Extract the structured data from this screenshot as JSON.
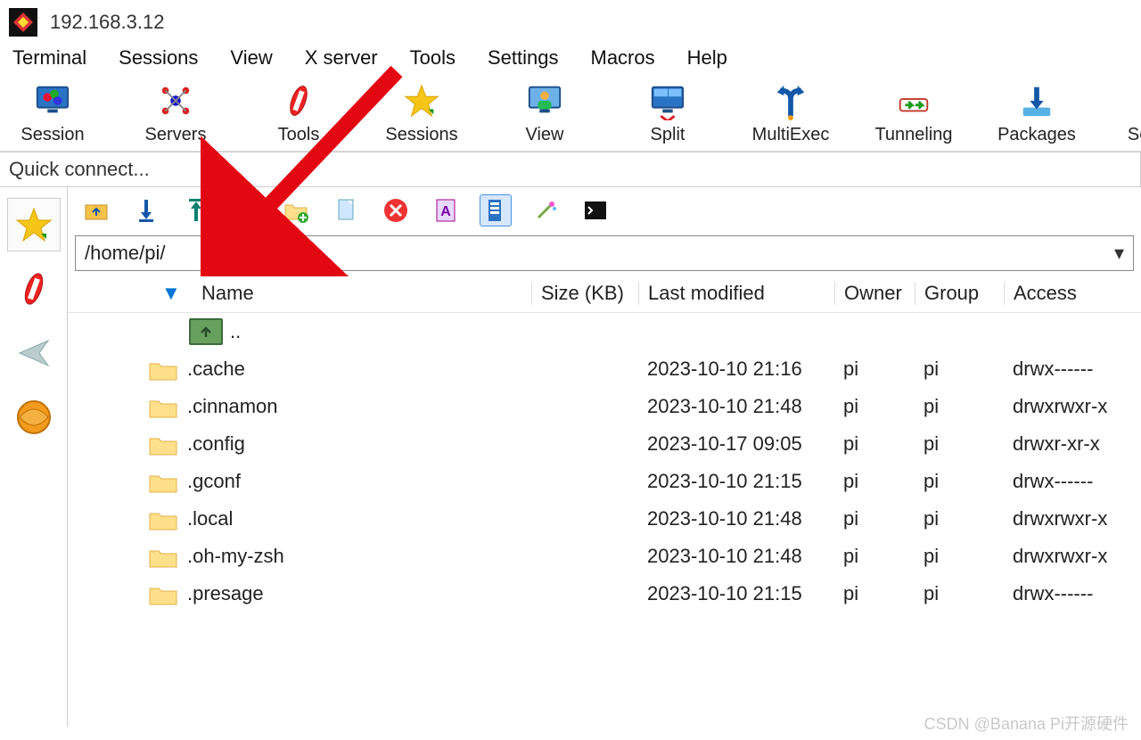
{
  "title": "192.168.3.12",
  "menubar": [
    "Terminal",
    "Sessions",
    "View",
    "X server",
    "Tools",
    "Settings",
    "Macros",
    "Help"
  ],
  "toolbar": [
    {
      "label": "Session",
      "icon": "monitor-rgb"
    },
    {
      "label": "Servers",
      "icon": "nodes"
    },
    {
      "label": "Tools",
      "icon": "swiss-red"
    },
    {
      "label": "Sessions",
      "icon": "star-yellow"
    },
    {
      "label": "View",
      "icon": "monitor-user"
    },
    {
      "label": "Split",
      "icon": "split-blue"
    },
    {
      "label": "MultiExec",
      "icon": "fork-blue"
    },
    {
      "label": "Tunneling",
      "icon": "tunnel-green"
    },
    {
      "label": "Packages",
      "icon": "download-blue"
    },
    {
      "label": "Settings",
      "icon": "gears-blue"
    }
  ],
  "quick_connect_label": "Quick connect...",
  "sidebuttons": [
    "star-yellow",
    "swiss-red",
    "send-gray",
    "globe-orange"
  ],
  "file_toolbar_icons": [
    "up-folder",
    "download-blue",
    "upload-teal",
    "refresh-green",
    "new-folder",
    "new-file",
    "delete-red",
    "font-file",
    "properties",
    "wand",
    "terminal"
  ],
  "path": "/home/pi/",
  "columns": {
    "name": "Name",
    "size": "Size (KB)",
    "modified": "Last modified",
    "owner": "Owner",
    "group": "Group",
    "access": "Access"
  },
  "up_label": "..",
  "files": [
    {
      "name": ".cache",
      "size": "",
      "modified": "2023-10-10 21:16",
      "owner": "pi",
      "group": "pi",
      "access": "drwx------"
    },
    {
      "name": ".cinnamon",
      "size": "",
      "modified": "2023-10-10 21:48",
      "owner": "pi",
      "group": "pi",
      "access": "drwxrwxr-x"
    },
    {
      "name": ".config",
      "size": "",
      "modified": "2023-10-17 09:05",
      "owner": "pi",
      "group": "pi",
      "access": "drwxr-xr-x"
    },
    {
      "name": ".gconf",
      "size": "",
      "modified": "2023-10-10 21:15",
      "owner": "pi",
      "group": "pi",
      "access": "drwx------"
    },
    {
      "name": ".local",
      "size": "",
      "modified": "2023-10-10 21:48",
      "owner": "pi",
      "group": "pi",
      "access": "drwxrwxr-x"
    },
    {
      "name": ".oh-my-zsh",
      "size": "",
      "modified": "2023-10-10 21:48",
      "owner": "pi",
      "group": "pi",
      "access": "drwxrwxr-x"
    },
    {
      "name": ".presage",
      "size": "",
      "modified": "2023-10-10 21:15",
      "owner": "pi",
      "group": "pi",
      "access": "drwx------"
    }
  ],
  "watermark": "CSDN @Banana Pi开源硬件"
}
